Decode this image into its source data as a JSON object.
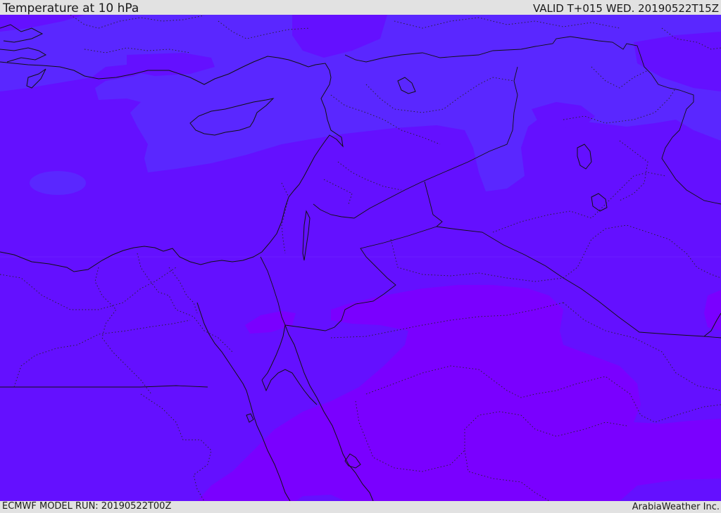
{
  "header": {
    "title": "Temperature at 10 hPa",
    "valid": "VALID T+015 WED. 20190522T15Z"
  },
  "footer": {
    "model_run": "ECMWF MODEL RUN: 20190522T00Z",
    "credit": "ArabiaWeather Inc."
  },
  "map": {
    "variable": "Temperature",
    "level": "10 hPa",
    "colors": {
      "band_coolest": "#5a27ff",
      "band_mid": "#6410ff",
      "band_warmest": "#7a00ff",
      "coastline": "#111111",
      "header_background": "#e2e2e2"
    }
  }
}
